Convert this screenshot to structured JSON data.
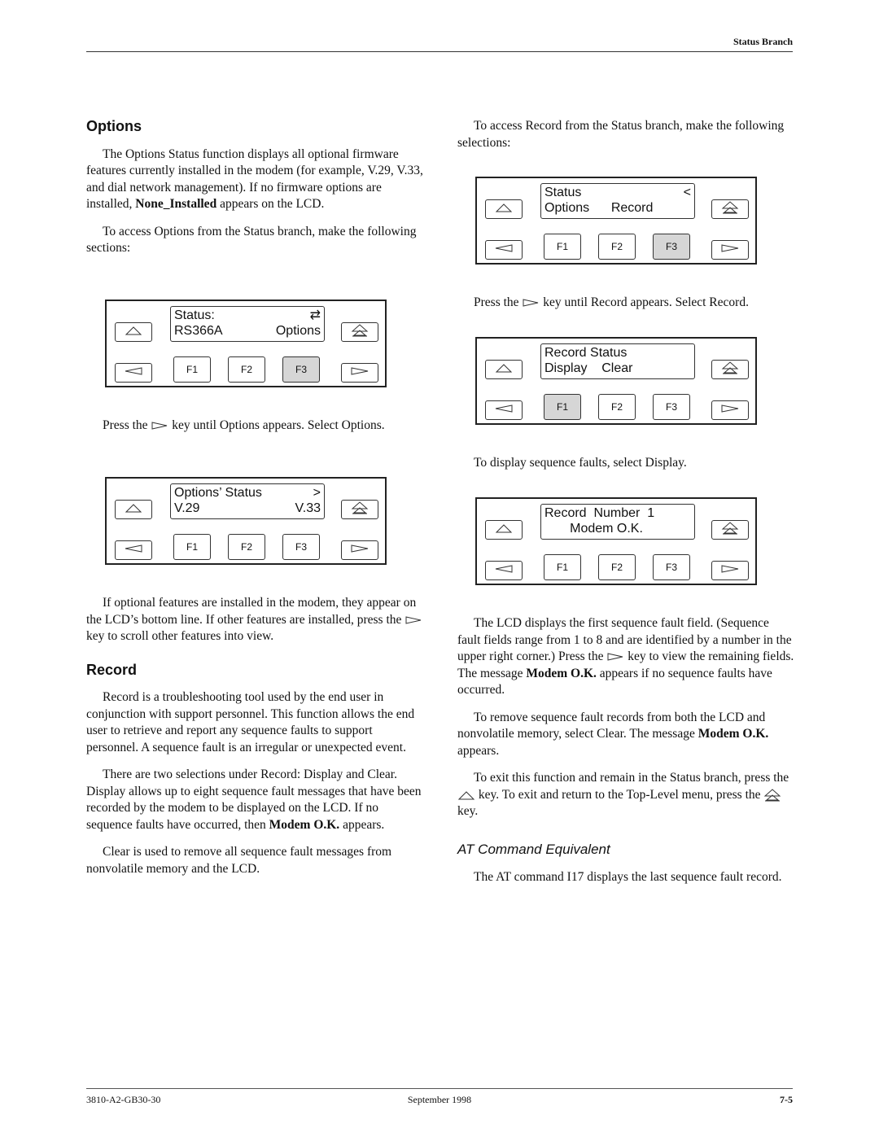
{
  "header": {
    "section": "Status Branch"
  },
  "footer": {
    "doc_number": "3810-A2-GB30-30",
    "date": "September 1998",
    "page": "7-5"
  },
  "left": {
    "options_heading": "Options",
    "p1_a": "The Options Status function displays all optional firmware features currently installed in the modem (for example, V.29, V.33, and dial network management). If no firmware options are installed, ",
    "p1_bold": "None_Installed",
    "p1_b": " appears on the LCD.",
    "p2": "To access Options from the Status branch, make the following sections:",
    "p3_a": "Press the ",
    "p3_b": " key until Options appears. Select Options.",
    "p4_a": "If optional features are installed in the modem, they appear on the LCD’s bottom line. If other features are installed, press the ",
    "p4_b": " key to scroll other features into view.",
    "record_heading": "Record",
    "p5": "Record is a troubleshooting tool used by the end user in conjunction with support personnel. This function allows the end user to retrieve and report any sequence faults to support personnel. A sequence fault is an irregular or unexpected event.",
    "p6_a": "There are two selections under Record: Display and Clear. Display allows up to eight sequence fault messages that have been recorded by the modem to be displayed on the LCD. If no sequence faults have occurred, then ",
    "p6_bold": "Modem O.K.",
    "p6_b": " appears.",
    "p7": "Clear is used to remove all sequence fault messages from nonvolatile memory and the LCD."
  },
  "right": {
    "p1": "To access Record from the Status branch, make the following selections:",
    "p2_a": "Press the ",
    "p2_b": " key until Record appears. Select Record.",
    "p3": "To display sequence faults, select Display.",
    "p4_a": "The LCD displays the first sequence fault field. (Sequence fault fields range from 1 to 8 and are identified by a number in the upper right corner.) Press the ",
    "p4_b": " key to view the remaining fields. The message ",
    "p4_bold": "Modem O.K.",
    "p4_c": " appears if no sequence faults have occurred.",
    "p5_a": "To remove sequence fault records from both the LCD and nonvolatile memory, select Clear. The message ",
    "p5_bold": "Modem O.K.",
    "p5_b": " appears.",
    "p6_a": "To exit this function and remain in the Status branch, press the ",
    "p6_b": " key. To exit and return to the Top-Level menu, press the ",
    "p6_c": " key.",
    "at_heading": "AT Command Equivalent",
    "p7": "The AT command I17 displays the last sequence fault record."
  },
  "panels": [
    {
      "line1_left": "Status:",
      "line1_right": "⇄",
      "line2_left": "RS366A",
      "line2_right": "Options",
      "f1": "F1",
      "f2": "F2",
      "f3": "F3",
      "selected": "F3"
    },
    {
      "line1_left": "Options’ Status",
      "line1_right": ">",
      "line2_left": "V.29",
      "line2_right": "V.33",
      "f1": "F1",
      "f2": "F2",
      "f3": "F3",
      "selected": ""
    },
    {
      "line1_left": "Status",
      "line1_right": "<",
      "line2_left": "Options      Record",
      "line2_right": "",
      "f1": "F1",
      "f2": "F2",
      "f3": "F3",
      "selected": "F3"
    },
    {
      "line1_left": "Record Status",
      "line1_right": "",
      "line2_left": "Display    Clear",
      "line2_right": "",
      "f1": "F1",
      "f2": "F2",
      "f3": "F3",
      "selected": "F1"
    },
    {
      "line1_left": "Record  Number  1",
      "line1_right": "",
      "line2_left": "       Modem O.K.",
      "line2_right": "",
      "f1": "F1",
      "f2": "F2",
      "f3": "F3",
      "selected": ""
    }
  ]
}
